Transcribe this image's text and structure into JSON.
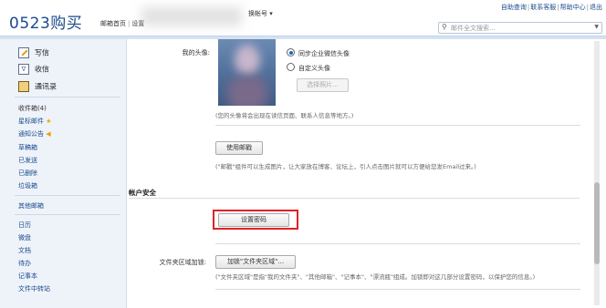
{
  "header": {
    "logo": "0523购买",
    "nav_first": "邮箱首页",
    "nav_second": "设置",
    "account_link": "换帐号 ▾",
    "top_links": [
      "自助查询",
      "联系客服",
      "帮助中心",
      "退出"
    ],
    "search_placeholder": "邮件全文搜索..."
  },
  "sidebar": {
    "compose": "写信",
    "inbox": "收信",
    "contacts": "通讯录",
    "folders": [
      {
        "label": "收件箱(4)",
        "style": "dark"
      },
      {
        "label": "星标邮件",
        "badge": "★"
      },
      {
        "label": "通知公告",
        "badge": "◀"
      },
      {
        "label": "草稿箱"
      },
      {
        "label": "已发送"
      },
      {
        "label": "已删除"
      },
      {
        "label": "垃圾箱"
      }
    ],
    "other_mailbox": "其他邮箱",
    "tools": [
      "日历",
      "微盘",
      "文档",
      "待办",
      "记事本",
      "文件中转站"
    ]
  },
  "settings": {
    "avatar_label": "我的头像:",
    "option_sync": "同步企业微信头像",
    "option_custom": "自定义头像",
    "select_photo": "选择照片...",
    "avatar_note": "(您的头像将会出现在读信页面、联系人信息等地方。)",
    "signature_button": "使用邮戳",
    "signature_note": "(\"邮戳\"组件可以生成图片，让大家放在博客、论坛上，引人点击图片就可以方便给您发Email过来。)",
    "security_title": "帐户安全",
    "password_button": "设置密码",
    "folder_label": "文件夹区域加锁:",
    "folder_button": "加锁\"文件夹区域\"...",
    "folder_note": "(\"文件夹区域\"是指\"我的文件夹\"、\"其他邮箱\"、\"记事本\"、\"漂流瓶\"组成。加锁即对这几部分设置密码，以保护您的信息。)"
  },
  "colors": {
    "highlight": "#e0212a",
    "brand": "#1a4a8c"
  }
}
